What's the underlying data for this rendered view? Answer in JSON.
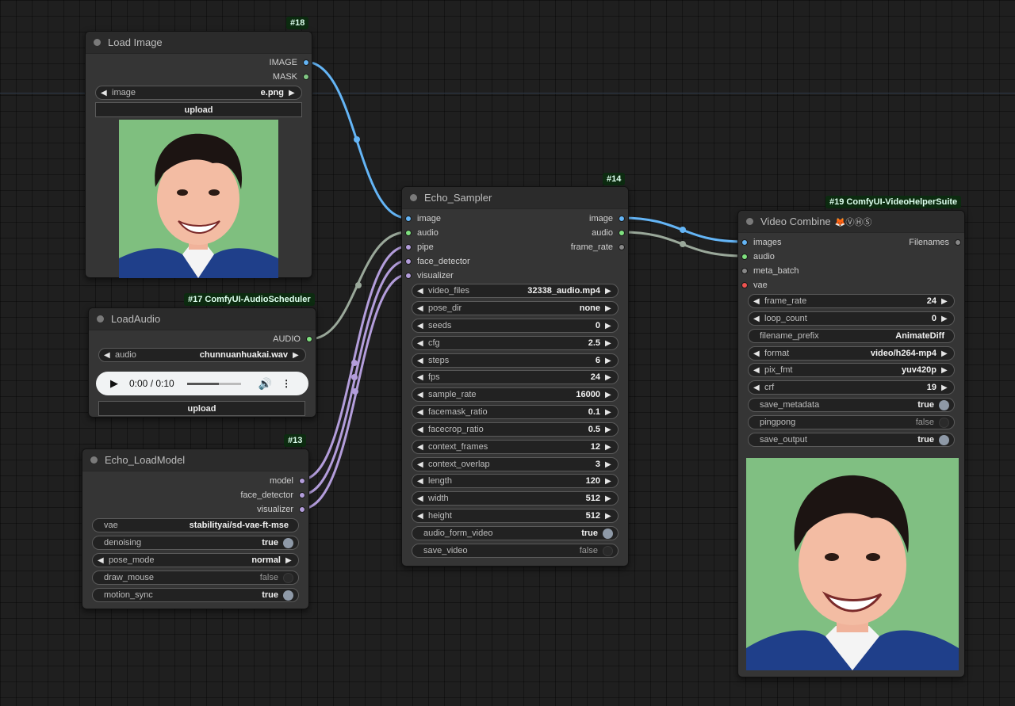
{
  "colors": {
    "image_link": "#64b5f6",
    "audio_link": "#9aa89a",
    "purple_link": "#b39ddb",
    "badge_bg": "#0c2b10"
  },
  "nodes": {
    "load_image": {
      "badge": "#18",
      "title": "Load Image",
      "outputs": [
        "IMAGE",
        "MASK"
      ],
      "image_widget": {
        "label": "image",
        "value": "e.png"
      },
      "upload_label": "upload"
    },
    "load_audio": {
      "badge": "#17 ComfyUI-AudioScheduler",
      "title": "LoadAudio",
      "outputs": [
        "AUDIO"
      ],
      "audio_widget": {
        "label": "audio",
        "value": "chunnuanhuakai.wav"
      },
      "player_time": "0:00 / 0:10",
      "upload_label": "upload"
    },
    "load_model": {
      "badge": "#13",
      "title": "Echo_LoadModel",
      "outputs": [
        "model",
        "face_detector",
        "visualizer"
      ],
      "widgets": [
        {
          "label": "vae",
          "value": "stabilityai/sd-vae-ft-mse"
        },
        {
          "label": "denoising",
          "value": "true"
        },
        {
          "label": "pose_mode",
          "value": "normal"
        },
        {
          "label": "draw_mouse",
          "value": "false"
        },
        {
          "label": "motion_sync",
          "value": "true"
        }
      ]
    },
    "sampler": {
      "badge": "#14",
      "title": "Echo_Sampler",
      "inputs": [
        "image",
        "audio",
        "pipe",
        "face_detector",
        "visualizer"
      ],
      "outputs": [
        "image",
        "audio",
        "frame_rate"
      ],
      "widgets": [
        {
          "label": "video_files",
          "value": "32338_audio.mp4"
        },
        {
          "label": "pose_dir",
          "value": "none"
        },
        {
          "label": "seeds",
          "value": "0"
        },
        {
          "label": "cfg",
          "value": "2.5"
        },
        {
          "label": "steps",
          "value": "6"
        },
        {
          "label": "fps",
          "value": "24"
        },
        {
          "label": "sample_rate",
          "value": "16000"
        },
        {
          "label": "facemask_ratio",
          "value": "0.1"
        },
        {
          "label": "facecrop_ratio",
          "value": "0.5"
        },
        {
          "label": "context_frames",
          "value": "12"
        },
        {
          "label": "context_overlap",
          "value": "3"
        },
        {
          "label": "length",
          "value": "120"
        },
        {
          "label": "width",
          "value": "512"
        },
        {
          "label": "height",
          "value": "512"
        },
        {
          "label": "audio_form_video",
          "value": "true"
        },
        {
          "label": "save_video",
          "value": "false"
        }
      ]
    },
    "video_combine": {
      "badge": "#19 ComfyUI-VideoHelperSuite",
      "title": "Video Combine",
      "title_icons": "🦊ⓋⒽⓈ",
      "inputs": [
        "images",
        "audio",
        "meta_batch",
        "vae"
      ],
      "outputs": [
        "Filenames"
      ],
      "widgets": [
        {
          "label": "frame_rate",
          "value": "24"
        },
        {
          "label": "loop_count",
          "value": "0"
        },
        {
          "label": "filename_prefix",
          "value": "AnimateDiff"
        },
        {
          "label": "format",
          "value": "video/h264-mp4"
        },
        {
          "label": "pix_fmt",
          "value": "yuv420p"
        },
        {
          "label": "crf",
          "value": "19"
        },
        {
          "label": "save_metadata",
          "value": "true"
        },
        {
          "label": "pingpong",
          "value": "false"
        },
        {
          "label": "save_output",
          "value": "true"
        }
      ]
    }
  }
}
